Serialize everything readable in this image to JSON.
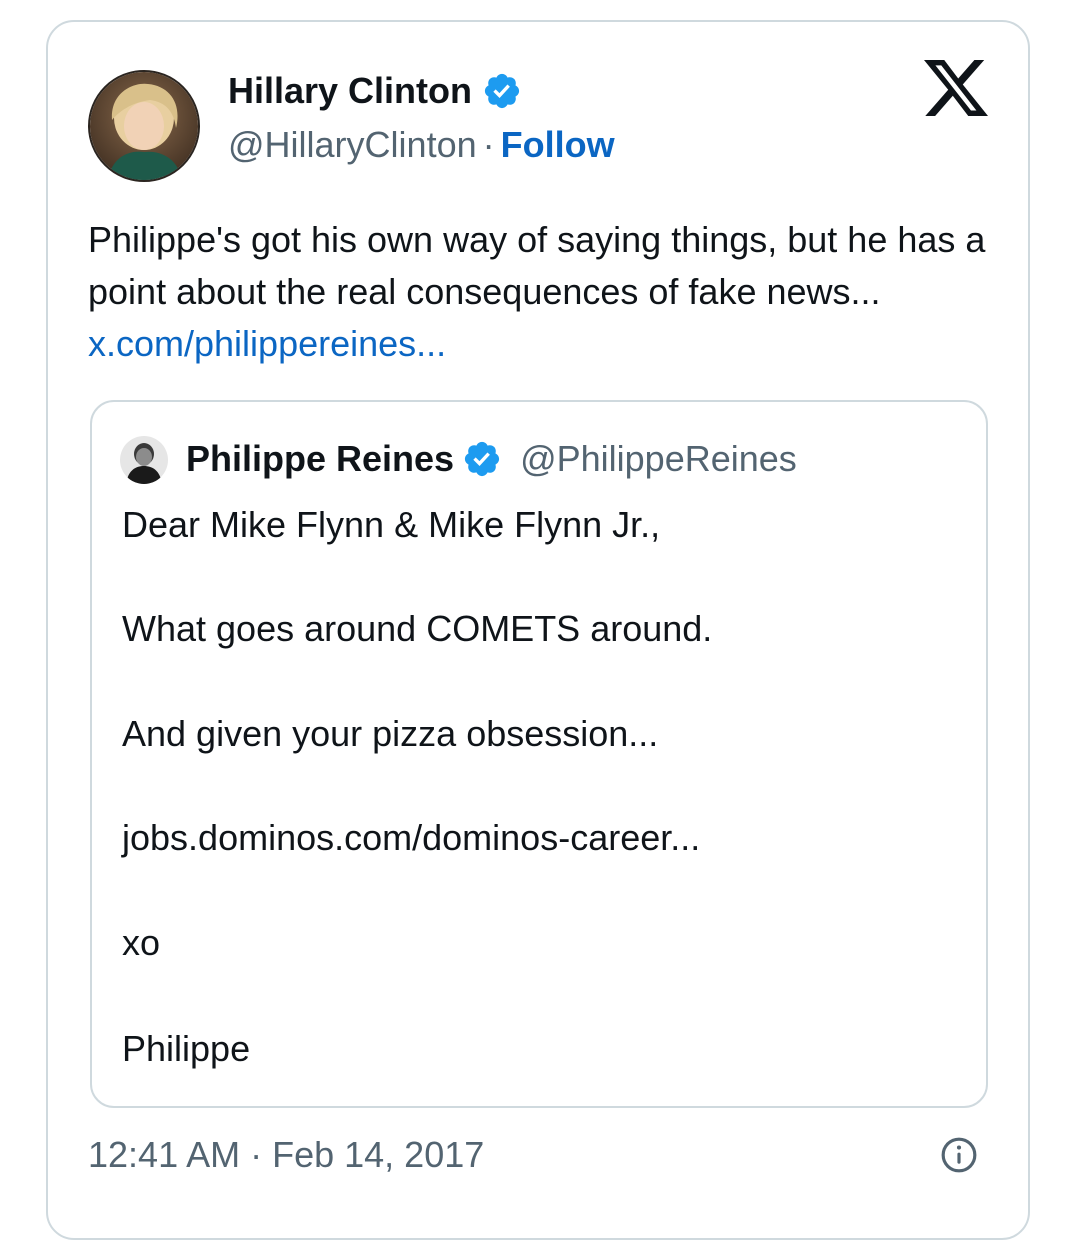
{
  "tweet": {
    "author": {
      "name": "Hillary Clinton",
      "handle": "@HillaryClinton",
      "verified": true,
      "avatar_icon": "profile-photo"
    },
    "separator": "·",
    "follow_label": "Follow",
    "text": "Philippe's got his own way of saying things, but he has a point about the real consequences of fake news...",
    "link": "x.com/philippereines...",
    "timestamp": "12:41 AM · Feb 14, 2017",
    "brand_icon": "x-logo-icon",
    "info_icon": "info-icon"
  },
  "quoted_tweet": {
    "author": {
      "name": "Philippe Reines",
      "handle": "@PhilippeReines",
      "verified": true,
      "avatar_icon": "profile-photo"
    },
    "lines": [
      "Dear Mike Flynn & Mike Flynn Jr.,",
      "What goes around COMETS around.",
      "And given your pizza obsession...",
      "jobs.dominos.com/dominos-career...",
      "xo",
      "Philippe"
    ]
  },
  "colors": {
    "text": "#0f1419",
    "secondary": "#536471",
    "link": "#0b66c3",
    "verified_badge": "#1d9bf0",
    "border": "#cfd9de"
  }
}
